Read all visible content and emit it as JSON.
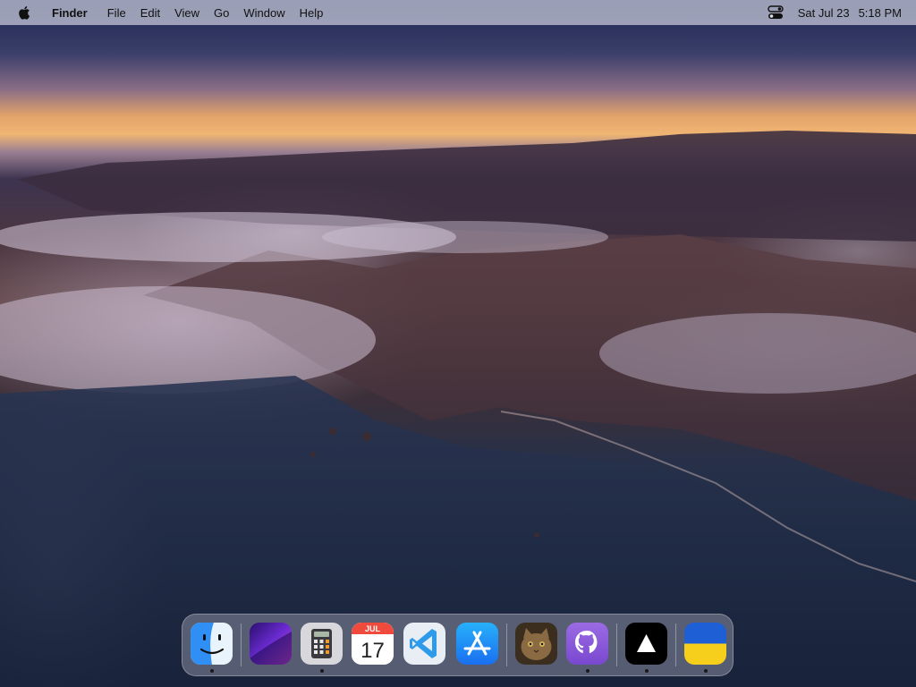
{
  "menubar": {
    "app_name": "Finder",
    "menus": [
      "File",
      "Edit",
      "View",
      "Go",
      "Window",
      "Help"
    ],
    "date": "Sat Jul 23",
    "time": "5:18 PM"
  },
  "dock": {
    "items": [
      {
        "id": "finder",
        "icon": "finder-icon",
        "running": true
      },
      {
        "id": "wallpaper-app",
        "icon": "purple-wallpaper-icon",
        "running": false
      },
      {
        "id": "calculator",
        "icon": "calculator-icon",
        "running": true
      },
      {
        "id": "calendar",
        "icon": "calendar-icon",
        "running": false,
        "month": "JUL",
        "day": "17"
      },
      {
        "id": "vscode",
        "icon": "vscode-icon",
        "running": false
      },
      {
        "id": "app-store",
        "icon": "app-store-icon",
        "running": false
      },
      {
        "id": "cat-photo",
        "icon": "cat-photo-icon",
        "running": false
      },
      {
        "id": "github-desktop",
        "icon": "github-icon",
        "running": true
      },
      {
        "id": "triangle-app",
        "icon": "triangle-icon",
        "running": true
      },
      {
        "id": "ukraine-flag",
        "icon": "ukraine-flag-icon",
        "running": true
      }
    ]
  },
  "colors": {
    "menubar_bg": "#bec0d2",
    "finder_blue": "#2f8ff5",
    "vscode_blue": "#2d9bea",
    "appstore_blue": "#1c8cf4",
    "github_purple": "#8e5fdc",
    "flag_blue": "#1f5fd6",
    "flag_yellow": "#f6cf1c"
  }
}
